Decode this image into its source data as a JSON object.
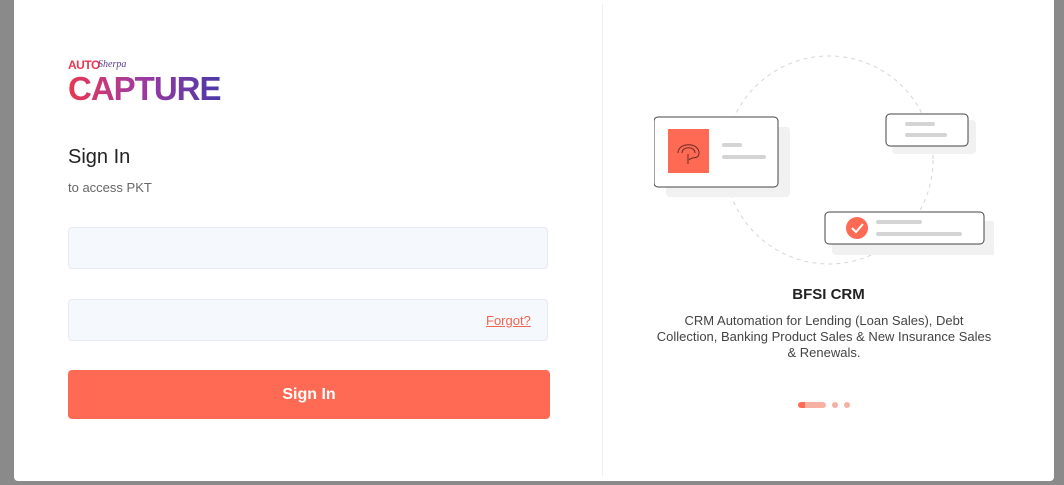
{
  "logo": {
    "line1": "AUTO",
    "line1_suffix": "Sherpa",
    "main": "CAPTURE"
  },
  "login": {
    "title": "Sign In",
    "subtitle": "to access PKT",
    "username_placeholder": "",
    "password_placeholder": "",
    "forgot_label": "Forgot?",
    "submit_label": "Sign In"
  },
  "carousel": {
    "title": "BFSI CRM",
    "description": "CRM Automation for Lending (Loan Sales), Debt Collection, Banking Product Sales & New Insurance Sales & Renewals.",
    "slide_count": 3,
    "active_index": 0
  },
  "colors": {
    "accent": "#ff6a55",
    "link": "#f2664f",
    "input_bg": "#f5f8fd",
    "backdrop": "#8a8a8a"
  },
  "icons": {
    "card_avatar": "fingerprint-icon",
    "status": "check-circle-icon"
  }
}
